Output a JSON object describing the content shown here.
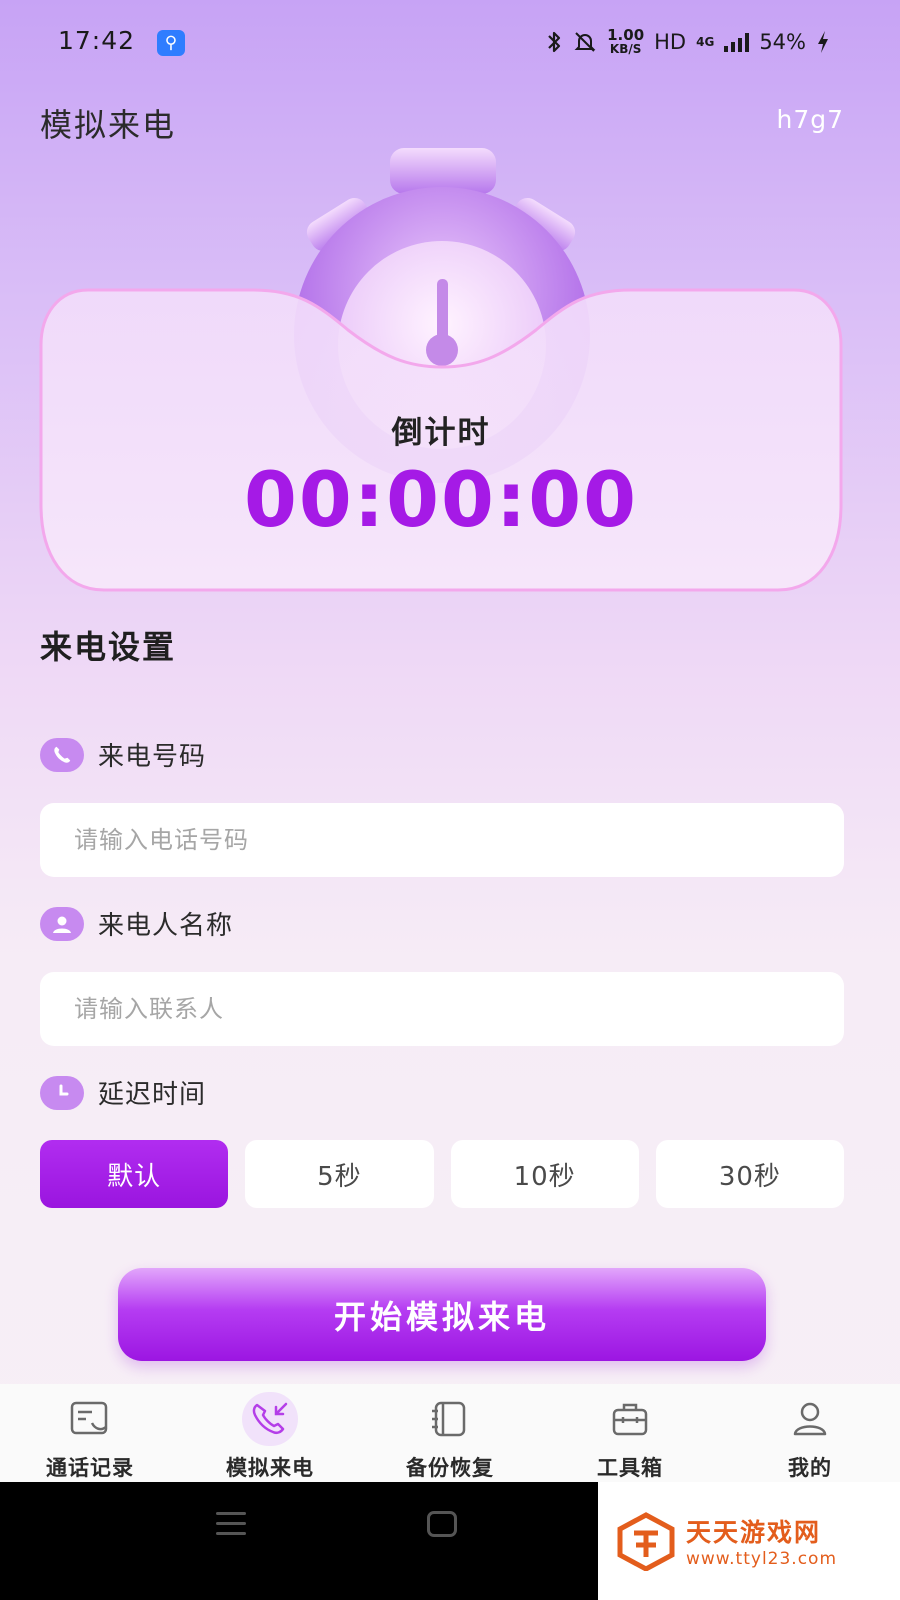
{
  "status_bar": {
    "time": "17:42",
    "speed_value": "1.00",
    "speed_unit": "KB/S",
    "hd": "HD",
    "network": "4G",
    "battery": "54%"
  },
  "header": {
    "title": "模拟来电",
    "code": "h7g7"
  },
  "countdown": {
    "label": "倒计时",
    "time": "00:00:00"
  },
  "settings": {
    "title": "来电设置",
    "phone": {
      "label": "来电号码",
      "placeholder": "请输入电话号码",
      "value": ""
    },
    "name": {
      "label": "来电人名称",
      "placeholder": "请输入联系人",
      "value": ""
    },
    "delay": {
      "label": "延迟时间",
      "options": [
        "默认",
        "5秒",
        "10秒",
        "30秒"
      ],
      "selected_index": 0
    },
    "start_button": "开始模拟来电"
  },
  "bottom_nav": {
    "items": [
      {
        "label": "通话记录",
        "icon": "call-log-icon"
      },
      {
        "label": "模拟来电",
        "icon": "incoming-call-icon"
      },
      {
        "label": "备份恢复",
        "icon": "backup-restore-icon"
      },
      {
        "label": "工具箱",
        "icon": "toolbox-icon"
      },
      {
        "label": "我的",
        "icon": "profile-icon"
      }
    ],
    "active_index": 1
  },
  "watermark": {
    "title": "天天游戏网",
    "url": "www.ttyl23.com"
  },
  "colors": {
    "accent": "#a51ae6",
    "icon_bg": "#c78af0"
  }
}
